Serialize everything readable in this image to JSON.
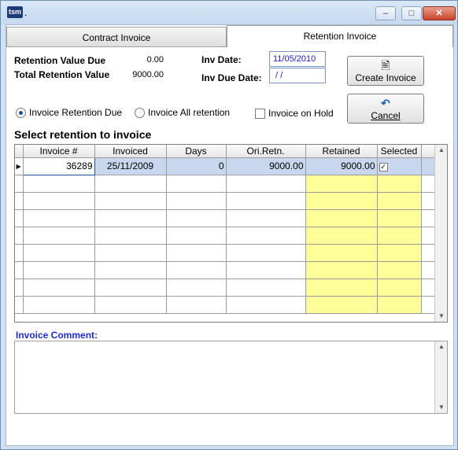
{
  "window": {
    "title": ".",
    "app_icon_text": "tsm",
    "minimize_symbol": "–",
    "maximize_symbol": "□",
    "close_symbol": "✕"
  },
  "tabs": [
    {
      "label": "Contract Invoice",
      "active": false
    },
    {
      "label": "Retention Invoice",
      "active": true
    }
  ],
  "summary": {
    "retention_value_due_label": "Retention Value Due",
    "retention_value_due": "0.00",
    "total_retention_label": "Total Retention Value",
    "total_retention": "9000.00",
    "inv_date_label": "Inv Date:",
    "inv_date": "11/05/2010",
    "inv_due_date_label": "Inv Due Date:",
    "inv_due_date": " / /"
  },
  "buttons": {
    "create_invoice": "Create Invoice",
    "cancel": "Cancel"
  },
  "options": {
    "invoice_retention_due": "Invoice Retention Due",
    "invoice_all_retention": "Invoice All retention",
    "invoice_on_hold": "Invoice on Hold",
    "selected_radio": "invoice_retention_due"
  },
  "grid": {
    "title": "Select retention to invoice",
    "columns": [
      "Invoice #",
      "Invoiced",
      "Days",
      "Ori.Retn.",
      "Retained",
      "Selected"
    ],
    "rows": [
      {
        "invoice": "36289",
        "invoiced": "25/11/2009",
        "days": "0",
        "ori_retn": "9000.00",
        "retained": "9000.00",
        "selected": true
      }
    ],
    "empty_rows": 8,
    "check_mark": "✓"
  },
  "comment": {
    "label": "Invoice Comment:",
    "value": ""
  },
  "colors": {
    "highlight_yellow": "#ffff99",
    "selected_row": "#c8d7ee",
    "date_text": "#1a1acc",
    "comment_label": "#1d2cc9"
  }
}
